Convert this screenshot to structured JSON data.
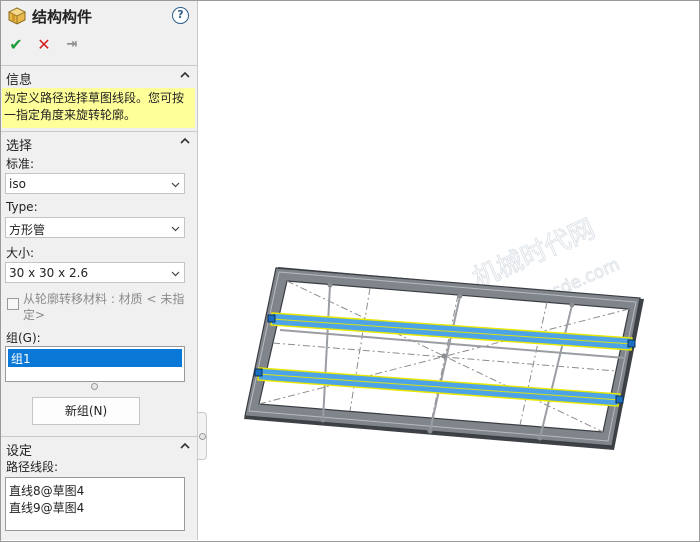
{
  "panel": {
    "title": "结构构件",
    "help_glyph": "?",
    "actions": {
      "ok": "✔",
      "cancel": "✕",
      "pin": "⇥"
    },
    "info": {
      "header": "信息",
      "message": "为定义路径选择草图线段。您可按一指定角度来旋转轮廓。"
    },
    "selection": {
      "header": "选择",
      "standard_label": "标准:",
      "standard_value": "iso",
      "type_label": "Type:",
      "type_value": "方形管",
      "size_label": "大小:",
      "size_value": "30 x 30 x 2.6",
      "transfer_label": "从轮廓转移材料 : 材质 < 未指定>",
      "transfer_checked": false,
      "groups_label": "组(G):",
      "groups": [
        "组1"
      ],
      "new_group_button": "新组(N)"
    },
    "settings": {
      "header": "设定",
      "path_label": "路径线段:",
      "path_segments": [
        "直线8@草图4",
        "直线9@草图4"
      ]
    }
  },
  "watermark": {
    "line1": "机械时代网",
    "line2": "www.jxsde.com"
  },
  "colors": {
    "panel_bg": "#f0f0f0",
    "info_bg": "#ffff99",
    "selection_blue": "#0a78d7",
    "member_fill": "#4da3e8",
    "member_outline": "#e8e800",
    "frame_gray": "#6e7278",
    "ok_green": "#1e9b3a",
    "cancel_red": "#d42020"
  }
}
